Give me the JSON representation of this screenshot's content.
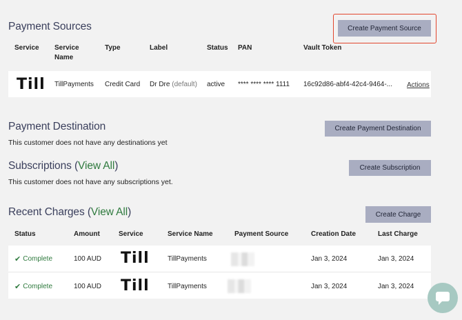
{
  "payment_sources": {
    "title": "Payment Sources",
    "create_button": "Create Payment Source",
    "headers": {
      "service": "Service",
      "service_name_1": "Service",
      "service_name_2": "Name",
      "type": "Type",
      "label": "Label",
      "status": "Status",
      "pan": "PAN",
      "vault_token": "Vault Token"
    },
    "row": {
      "service_logo": "Till",
      "service_name": "TillPayments",
      "type": "Credit Card",
      "label": "Dr Dre",
      "label_default": "(default)",
      "status": "active",
      "pan": "**** **** **** 1111",
      "vault_token": "16c92d86-abf4-42c4-9464-...",
      "actions": "Actions"
    }
  },
  "payment_destination": {
    "title": "Payment Destination",
    "create_button": "Create Payment Destination",
    "note": "This customer does not have any destinations yet"
  },
  "subscriptions": {
    "title": "Subscriptions",
    "open_paren": "(",
    "view_all": "View All",
    "close_paren": ")",
    "create_button": "Create Subscription",
    "note": "This customer does not have any subscriptions yet."
  },
  "recent_charges": {
    "title": "Recent Charges",
    "open_paren": "(",
    "view_all": "View All",
    "close_paren": ")",
    "create_button": "Create Charge",
    "headers": {
      "status": "Status",
      "amount": "Amount",
      "service": "Service",
      "service_name": "Service Name",
      "payment_source": "Payment Source",
      "creation_date": "Creation Date",
      "last_charge": "Last Charge"
    },
    "rows": [
      {
        "status": "Complete",
        "amount": "100 AUD",
        "service_logo": "Till",
        "service_name": "TillPayments",
        "creation_date": "Jan 3, 2024",
        "last_charge": "Jan 3, 2024"
      },
      {
        "status": "Complete",
        "amount": "100 AUD",
        "service_logo": "Till",
        "service_name": "TillPayments",
        "creation_date": "Jan 3, 2024",
        "last_charge": "Jan 3, 2024"
      }
    ]
  },
  "icons": {
    "check": "check-icon",
    "chat": "chat-bubble-icon"
  },
  "colors": {
    "accent_button": "#a9adc1",
    "link_green": "#2f7a3e",
    "highlight": "#e2452d",
    "title": "#3a3f5c"
  }
}
